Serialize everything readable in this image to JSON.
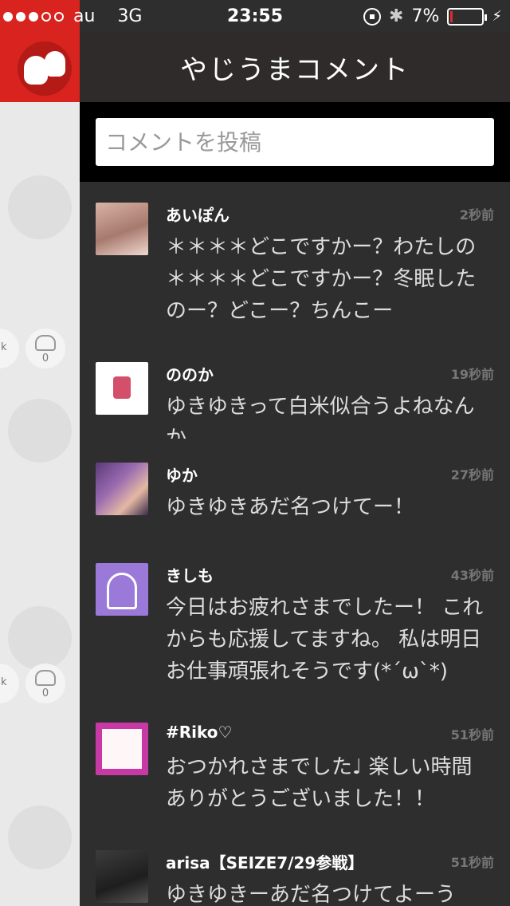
{
  "status_bar": {
    "carrier": "au",
    "network": "3G",
    "time": "23:55",
    "battery_text": "7%",
    "battery_fraction": 0.07,
    "battery_color": "#e02a2a",
    "signal_bars_filled": 3,
    "signal_bars_total": 5
  },
  "header": {
    "title": "やじうまコメント"
  },
  "compose": {
    "placeholder": "コメントを投稿"
  },
  "side_panel": {
    "actions": [
      {
        "label": "alk",
        "count": "0"
      },
      {
        "label": "alk",
        "count": "0"
      }
    ]
  },
  "comments": [
    {
      "name": "あいぽん",
      "time": "2秒前",
      "text": "＊＊＊＊どこですかー？わたしの＊＊＊＊どこですかー？冬眠したのー？どこー？ちんこー"
    },
    {
      "name": "ののか",
      "time": "19秒前",
      "text": "ゆきゆきって白米似合うよねなんか"
    },
    {
      "name": "ゆか",
      "time": "27秒前",
      "text": "ゆきゆきあだ名つけてー！"
    },
    {
      "name": "きしも",
      "time": "43秒前",
      "text": "今日はお疲れさまでしたー！ これからも応援してますね。 私は明日お仕事頑張れそうです(*´ω`*)"
    },
    {
      "name": "#Riko♡",
      "time": "51秒前",
      "text": "おつかれさまでした♩ 楽しい時間ありがとうございました！！"
    },
    {
      "name": "arisa【SEIZE7/29参戦】",
      "time": "51秒前",
      "text": "ゆきゆきーあだ名つけてよーう"
    }
  ],
  "colors": {
    "brand_red": "#d8231f",
    "background_dark": "#2e2e2e"
  }
}
